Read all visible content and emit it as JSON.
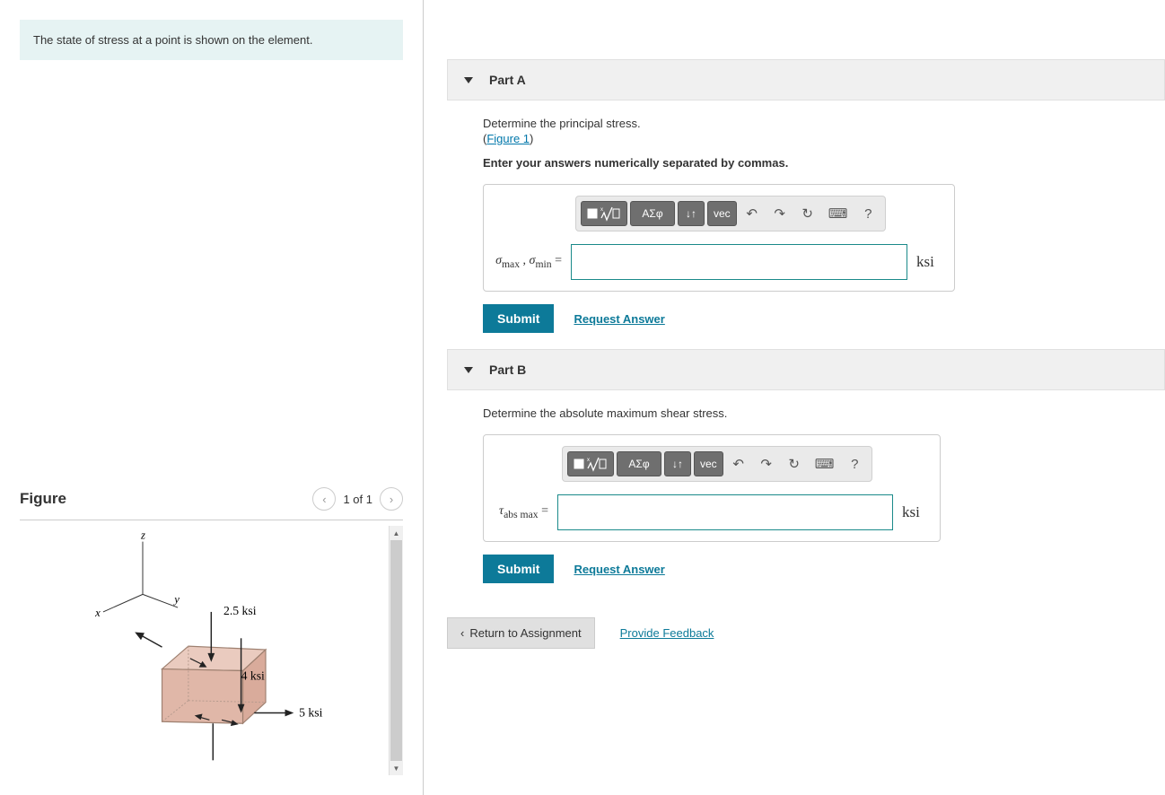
{
  "problem": {
    "statement": "The state of stress at a point is shown on the element."
  },
  "figure": {
    "title": "Figure",
    "page_indicator": "1 of 1",
    "labels": {
      "axis_x": "x",
      "axis_y": "y",
      "axis_z": "z",
      "stress_1": "2.5 ksi",
      "stress_2": "4 ksi",
      "stress_3": "5 ksi"
    }
  },
  "partA": {
    "title": "Part A",
    "instruction": "Determine the principal stress.",
    "figure_link": "Figure 1",
    "format_instruction": "Enter your answers numerically separated by commas.",
    "var_html": "<i>σ</i><sub>max</sub> , <i>σ</i><sub>min</sub> =",
    "unit": "ksi",
    "submit": "Submit",
    "request": "Request Answer"
  },
  "partB": {
    "title": "Part B",
    "instruction": "Determine the absolute maximum shear stress.",
    "var_html": "<i>τ</i><sub>abs max</sub> =",
    "unit": "ksi",
    "submit": "Submit",
    "request": "Request Answer"
  },
  "toolbar": {
    "math": "ΑΣφ",
    "sort": "↓↑",
    "vec": "vec",
    "undo": "↶",
    "redo": "↷",
    "reset": "↻",
    "keyboard": "⌨",
    "help": "?"
  },
  "footer": {
    "return": "Return to Assignment",
    "feedback": "Provide Feedback"
  }
}
